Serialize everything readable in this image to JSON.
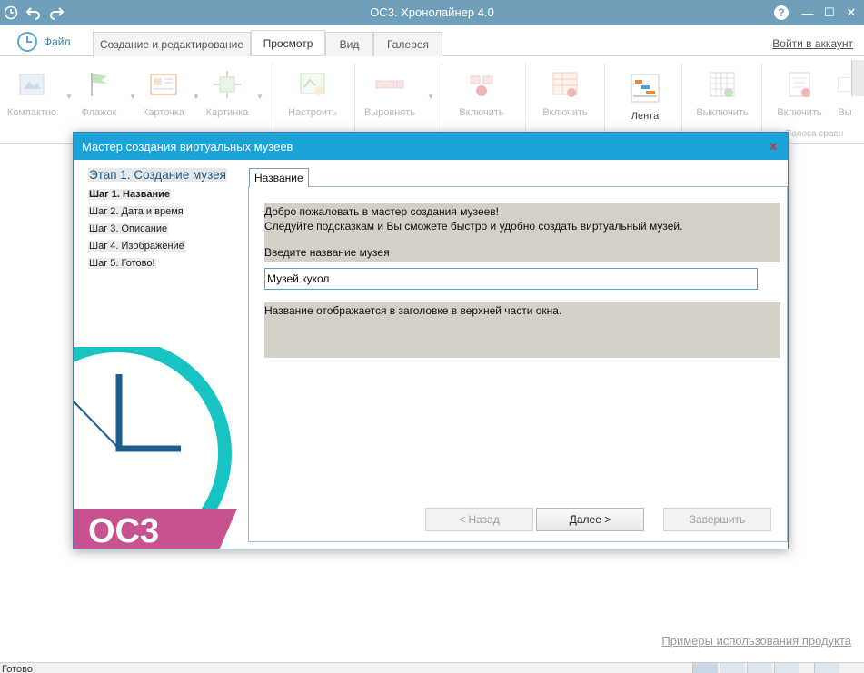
{
  "app": {
    "title": "ОС3. Хронолайнер 4.0",
    "colors": {
      "titlebar": "#6f9fbb",
      "dialog_title": "#1ba2d6",
      "logo_teal": "#18c3c4",
      "logo_blue": "#1f5d8c",
      "logo_pink": "#c8528f"
    }
  },
  "quick_access": {
    "icons": [
      "app-clock-icon",
      "undo-icon",
      "redo-icon"
    ]
  },
  "window_controls": {
    "help": "?",
    "minimize": "—",
    "maximize": "☐",
    "close": "✕"
  },
  "tabs": {
    "file": "Файл",
    "items": [
      "Создание и редактирование",
      "Просмотр",
      "Вид",
      "Галерея"
    ],
    "active": "Просмотр",
    "account": "Войти в аккаунт"
  },
  "ribbon": {
    "buttons": [
      {
        "label": "Компактно"
      },
      {
        "label": "Флажок"
      },
      {
        "label": "Карточка"
      },
      {
        "label": "Картинка"
      },
      {
        "label": "Настроить"
      },
      {
        "label": "Выровнять"
      },
      {
        "label": "Включить"
      },
      {
        "label": "Включить"
      },
      {
        "label": "Лента"
      },
      {
        "label": "Выключить"
      },
      {
        "label": "Включить"
      },
      {
        "label": "Вы"
      }
    ],
    "group_label": "Полоса сравн"
  },
  "dialog": {
    "title": "Мастер создания виртуальных музеев",
    "close": "x",
    "stage": "Этап 1. Создание музея",
    "steps": [
      "Шаг 1. Название",
      "Шаг 2. Дата и время",
      "Шаг 3. Описание",
      "Шаг 4. Изображение",
      "Шаг 5. Готово!"
    ],
    "tab": "Название",
    "welcome_line1": "Добро пожаловать в мастер создания музеев!",
    "welcome_line2": "Следуйте подсказкам и Вы сможете быстро и удобно создать виртуальный музей.",
    "prompt": "Введите название музея",
    "name_value": "Музей кукол",
    "hint": "Название отображается в заголовке в верхней части окна.",
    "logo_text": "ОС3",
    "buttons": {
      "back": "< Назад",
      "next": "Далее >",
      "finish": "Завершить"
    }
  },
  "footer": {
    "examples_link": "Примеры использования продукта",
    "status": "Готово"
  }
}
